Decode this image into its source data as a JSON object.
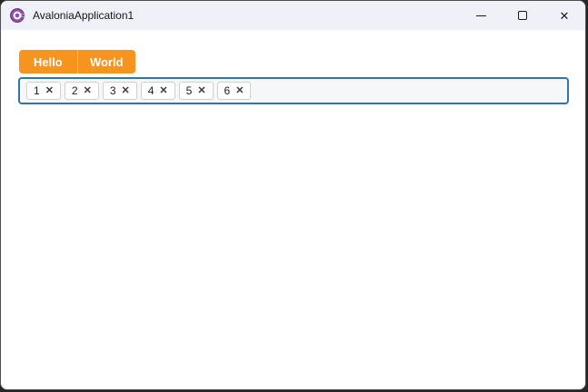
{
  "window": {
    "title": "AvaloniaApplication1",
    "controls": {
      "minimize": "minimize",
      "maximize": "maximize",
      "close_glyph": "✕"
    }
  },
  "tabstrip": {
    "tabs": [
      {
        "label": "Hello"
      },
      {
        "label": "World"
      }
    ]
  },
  "chips": {
    "remove_icon": "✕",
    "items": [
      {
        "label": "1"
      },
      {
        "label": "2"
      },
      {
        "label": "3"
      },
      {
        "label": "4"
      },
      {
        "label": "5"
      },
      {
        "label": "6"
      }
    ]
  },
  "colors": {
    "accent_orange": "#f7941e",
    "field_border_blue": "#2f76ad",
    "titlebar_bg": "#eef2f8",
    "logo_purple": "#8e4fa8"
  }
}
